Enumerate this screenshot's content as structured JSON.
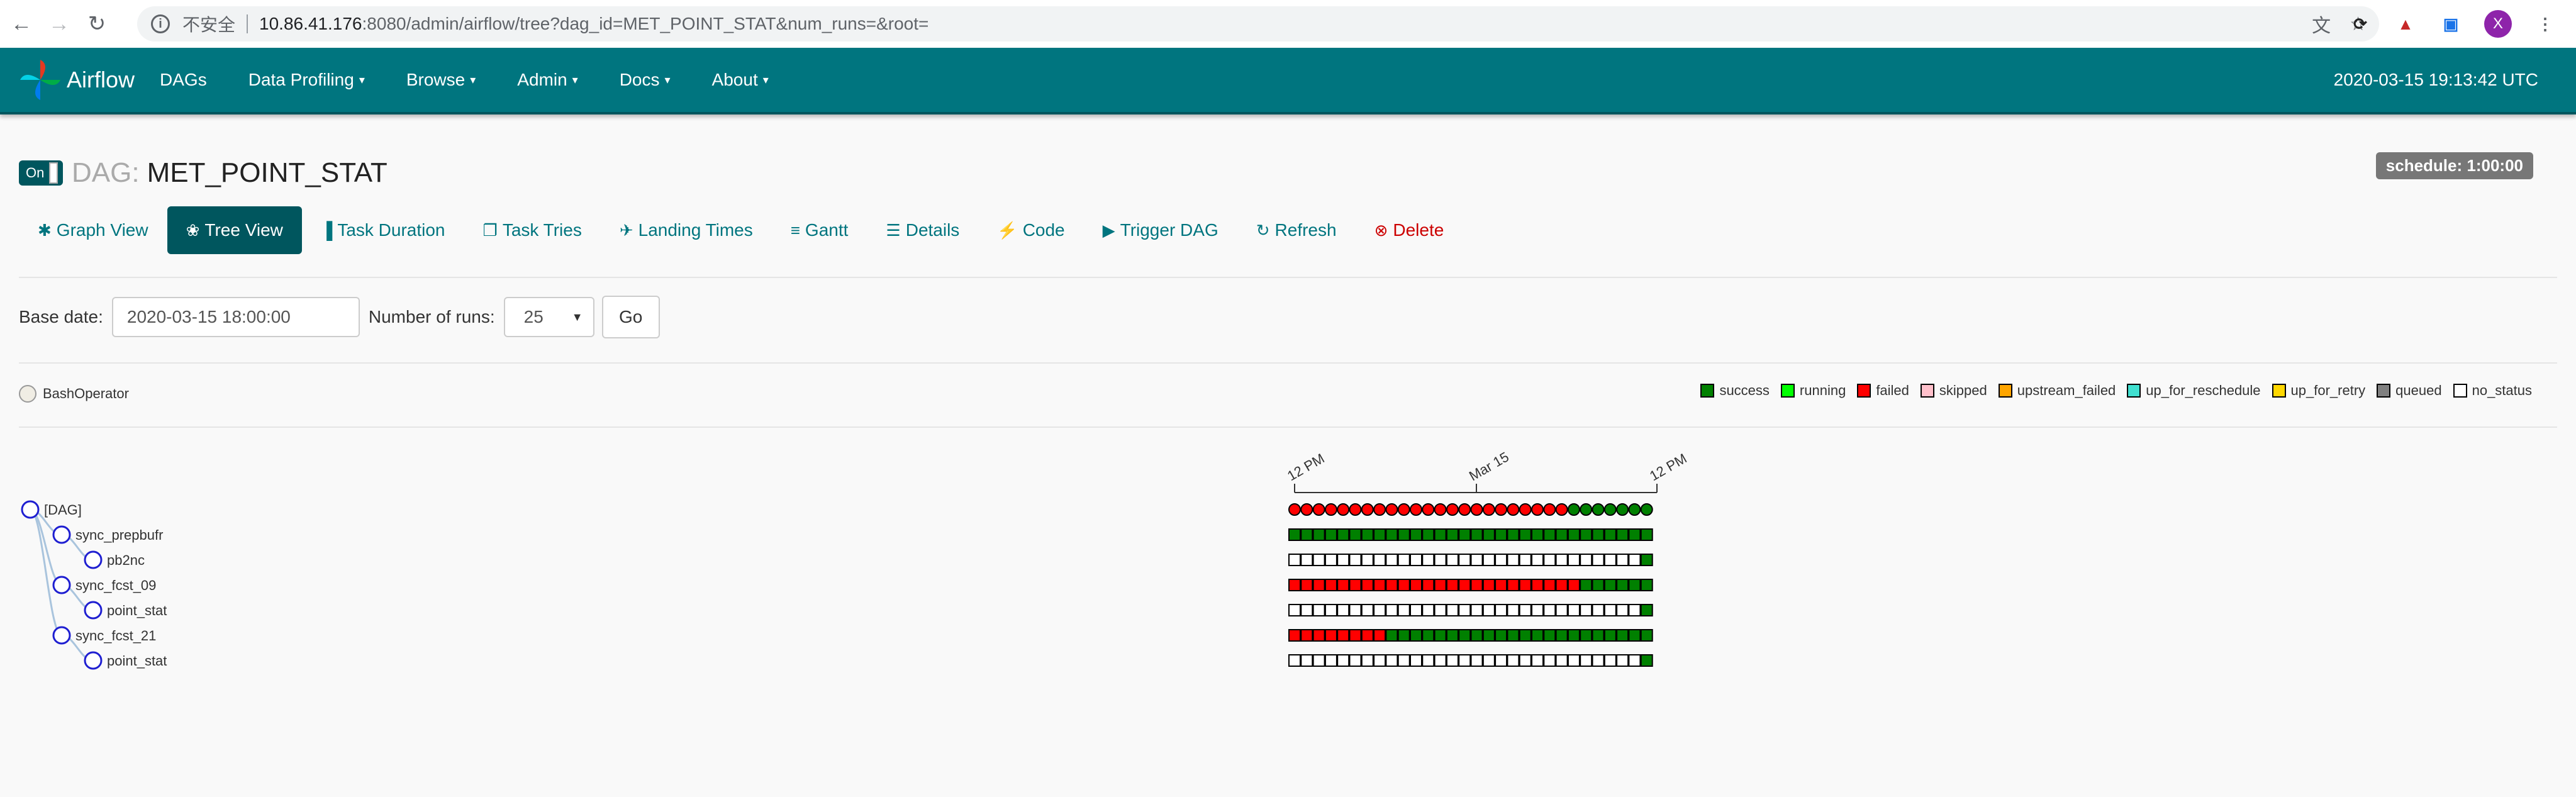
{
  "browser": {
    "insecure_label": "不安全",
    "url_host": "10.86.41.176",
    "url_rest": ":8080/admin/airflow/tree?dag_id=MET_POINT_STAT&num_runs=&root=",
    "avatar_letter": "X"
  },
  "navbar": {
    "brand": "Airflow",
    "items": [
      {
        "label": "DAGs",
        "dropdown": false
      },
      {
        "label": "Data Profiling",
        "dropdown": true
      },
      {
        "label": "Browse",
        "dropdown": true
      },
      {
        "label": "Admin",
        "dropdown": true
      },
      {
        "label": "Docs",
        "dropdown": true
      },
      {
        "label": "About",
        "dropdown": true
      }
    ],
    "clock": "2020-03-15 19:13:42 UTC",
    "bg_color": "#00757f"
  },
  "dag": {
    "toggle_label": "On",
    "prefix": "DAG:",
    "name": "MET_POINT_STAT",
    "schedule": "schedule: 1:00:00"
  },
  "tabs": [
    {
      "label": "Graph View",
      "icon": "asterisk-icon",
      "active": false
    },
    {
      "label": "Tree View",
      "icon": "tree-icon",
      "active": true
    },
    {
      "label": "Task Duration",
      "icon": "bar-chart-icon",
      "active": false
    },
    {
      "label": "Task Tries",
      "icon": "duplicate-icon",
      "active": false
    },
    {
      "label": "Landing Times",
      "icon": "plane-icon",
      "active": false
    },
    {
      "label": "Gantt",
      "icon": "gantt-icon",
      "active": false
    },
    {
      "label": "Details",
      "icon": "list-icon",
      "active": false
    },
    {
      "label": "Code",
      "icon": "flash-icon",
      "active": false
    },
    {
      "label": "Trigger DAG",
      "icon": "play-circle-icon",
      "active": false
    },
    {
      "label": "Refresh",
      "icon": "refresh-icon",
      "active": false
    },
    {
      "label": "Delete",
      "icon": "remove-circle-icon",
      "active": false
    }
  ],
  "form": {
    "base_date_label": "Base date:",
    "base_date_value": "2020-03-15 18:00:00",
    "num_runs_label": "Number of runs:",
    "num_runs_value": "25",
    "go_label": "Go"
  },
  "operator": {
    "name": "BashOperator"
  },
  "legend": [
    {
      "label": "success",
      "color": "#008000"
    },
    {
      "label": "running",
      "color": "#00ff00"
    },
    {
      "label": "failed",
      "color": "#ff0000"
    },
    {
      "label": "skipped",
      "color": "#ffc0cb"
    },
    {
      "label": "upstream_failed",
      "color": "#ffa500"
    },
    {
      "label": "up_for_reschedule",
      "color": "#40e0d0"
    },
    {
      "label": "up_for_retry",
      "color": "#ffd700"
    },
    {
      "label": "queued",
      "color": "#808080"
    },
    {
      "label": "no_status",
      "color": "#ffffff"
    }
  ],
  "timeline": {
    "ticks": [
      "12 PM",
      "Mar 15",
      "12 PM"
    ]
  },
  "tree": {
    "nodes": [
      {
        "label": "[DAG]",
        "depth": 0
      },
      {
        "label": "sync_prepbufr",
        "depth": 1
      },
      {
        "label": "pb2nc",
        "depth": 2
      },
      {
        "label": "sync_fcst_09",
        "depth": 1
      },
      {
        "label": "point_stat",
        "depth": 2
      },
      {
        "label": "sync_fcst_21",
        "depth": 1
      },
      {
        "label": "point_stat",
        "depth": 2
      }
    ],
    "dag_runs": "FFFFFFFFFFFFFFFFFFFFFFFSSSSSSS",
    "task_rows": [
      "SSSSSSSSSSSSSSSSSSSSSSSSSSSSSS",
      "NNNNNNNNNNNNNNNNNNNNNNNNNNNNNS",
      "FFFFFFFFFFFFFFFFFFFFFFFFSSSSSS",
      "NNNNNNNNNNNNNNNNNNNNNNNNNNNNNS",
      "FFFFFFFFSSSSSSSSSSSSSSSSSSSSSS",
      "NNNNNNNNNNNNNNNNNNNNNNNNNNNNNS"
    ],
    "status_colors": {
      "S": "#008000",
      "F": "#ff0000",
      "N": "#ffffff"
    }
  }
}
